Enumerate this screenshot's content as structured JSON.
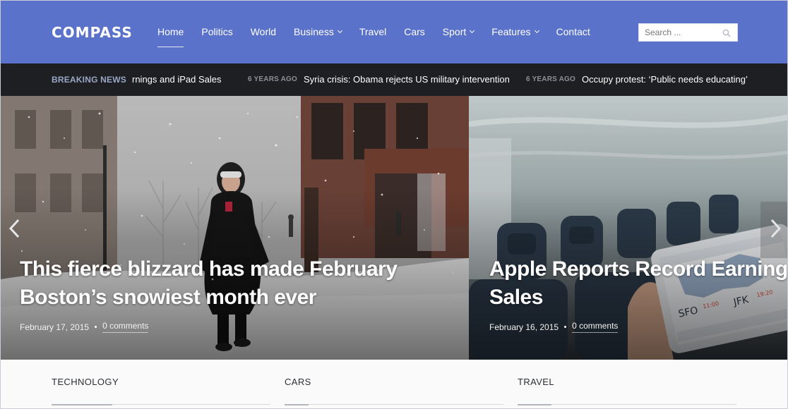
{
  "brand": {
    "logo": "COMPASS"
  },
  "nav": {
    "items": [
      {
        "label": "Home",
        "active": true,
        "dropdown": false
      },
      {
        "label": "Politics",
        "active": false,
        "dropdown": false
      },
      {
        "label": "World",
        "active": false,
        "dropdown": false
      },
      {
        "label": "Business",
        "active": false,
        "dropdown": true
      },
      {
        "label": "Travel",
        "active": false,
        "dropdown": false
      },
      {
        "label": "Cars",
        "active": false,
        "dropdown": false
      },
      {
        "label": "Sport",
        "active": false,
        "dropdown": true
      },
      {
        "label": "Features",
        "active": false,
        "dropdown": true
      },
      {
        "label": "Contact",
        "active": false,
        "dropdown": false
      }
    ]
  },
  "search": {
    "placeholder": "Search ...",
    "icon": "search-icon"
  },
  "breaking": {
    "label": "BREAKING NEWS",
    "items": [
      {
        "time": "",
        "title": "rnings and iPad Sales"
      },
      {
        "time": "6 YEARS AGO",
        "title": "Syria crisis: Obama rejects US military intervention"
      },
      {
        "time": "6 YEARS AGO",
        "title": "Occupy protest: ‘Public needs educating’"
      }
    ]
  },
  "slides": [
    {
      "title_line1": "This fierce blizzard has made February",
      "title_line2": "Boston’s snowiest month ever",
      "date": "February 17, 2015",
      "comments": "0 comments"
    },
    {
      "title_line1": "Apple Reports Record Earnings and iPad",
      "title_line2": "Sales",
      "date": "February 16, 2015",
      "comments": "0 comments"
    }
  ],
  "slider_controls": {
    "prev_icon": "chevron-left-icon",
    "next_icon": "chevron-right-icon"
  },
  "categories": [
    {
      "label": "TECHNOLOGY"
    },
    {
      "label": "CARS"
    },
    {
      "label": "TRAVEL"
    }
  ],
  "colors": {
    "header_bg": "#5a72c9",
    "breaking_bg": "#1e1f22",
    "breaking_label": "#9aa7c6"
  }
}
